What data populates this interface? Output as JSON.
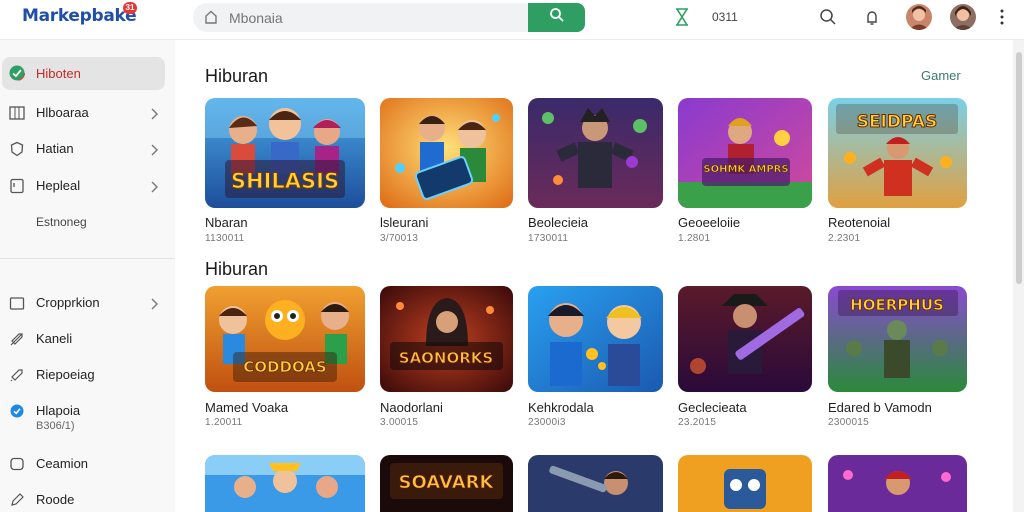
{
  "header": {
    "logo_text": "Markepbake",
    "logo_badge": "31",
    "search_placeholder": "Mbonaia",
    "counter_text": "0311",
    "accent_color": "#2e9e63"
  },
  "sidebar": {
    "items": [
      {
        "label": "Hiboten",
        "icon": "shield-check-icon",
        "active": true
      },
      {
        "label": "Hlboaraa",
        "icon": "grid-icon",
        "chevron": true
      },
      {
        "label": "Hatian",
        "icon": "badge-icon",
        "chevron": true
      },
      {
        "label": "Hepleal",
        "icon": "bookmark-icon",
        "chevron": true
      },
      {
        "label": "Estnoneg"
      },
      {
        "label": "Cropprkion",
        "icon": "folder-icon",
        "chevron": true
      },
      {
        "label": "Kaneli",
        "icon": "tag-icon"
      },
      {
        "label": "Riepoeiag",
        "icon": "tag-icon"
      },
      {
        "label": "Hlapoia",
        "sub": "B306/1)",
        "icon": "blue-check-icon"
      },
      {
        "label": "Ceamion",
        "icon": "chat-icon"
      },
      {
        "label": "Roode",
        "icon": "pencil-icon"
      }
    ]
  },
  "main": {
    "section1_title": "Hiburan",
    "section1_link": "Gamer",
    "section2_title": "Hiburan",
    "row1": [
      {
        "title": "Nbaran",
        "sub": "1130011",
        "thumb_text": "SHILASIS"
      },
      {
        "title": "lsleurani",
        "sub": "3/70013",
        "thumb_text": ""
      },
      {
        "title": "Beolecieia",
        "sub": "1730011",
        "thumb_text": ""
      },
      {
        "title": "Geoeeloiie",
        "sub": "1.2801",
        "thumb_text": "SOHMK AMPRS"
      },
      {
        "title": "Reotenoial",
        "sub": "2.2301",
        "thumb_text": "SEIDPAS"
      }
    ],
    "row2": [
      {
        "title": "Mamed Voaka",
        "sub": "1.20011",
        "thumb_text": "CODDOAS"
      },
      {
        "title": "Naodorlani",
        "sub": "3.00015",
        "thumb_text": "SAONORKS"
      },
      {
        "title": "Kehkrodala",
        "sub": "23000i3",
        "thumb_text": ""
      },
      {
        "title": "Geclecieata",
        "sub": "23.2015",
        "thumb_text": ""
      },
      {
        "title": "Edared b Vamodn",
        "sub": "2300015",
        "thumb_text": "HOERPHUS"
      }
    ],
    "row3": [
      {
        "thumb_text": ""
      },
      {
        "thumb_text": "SOAVARK"
      },
      {
        "thumb_text": ""
      },
      {
        "thumb_text": ""
      },
      {
        "thumb_text": ""
      }
    ]
  }
}
